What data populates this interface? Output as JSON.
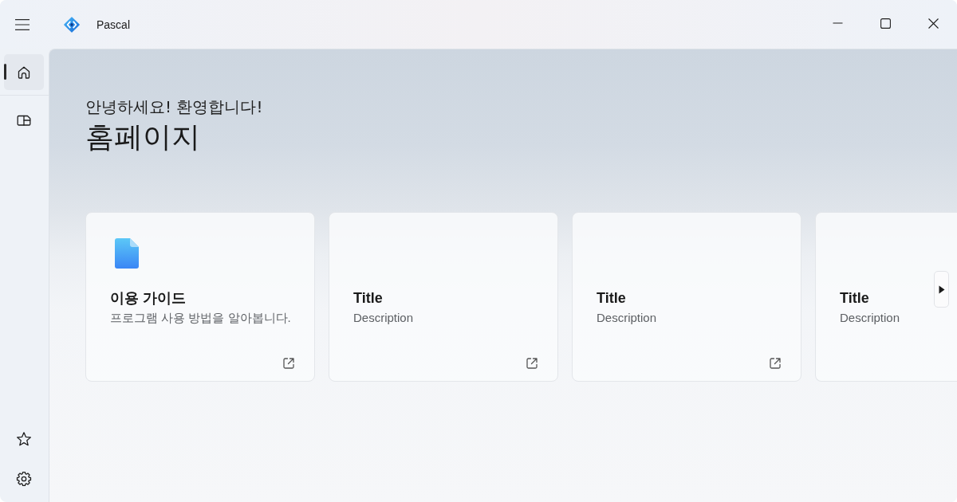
{
  "window": {
    "title": "Pascal"
  },
  "nav": {
    "sections": [
      {
        "items": [
          {
            "kind": "home",
            "selected": true
          }
        ]
      },
      {
        "items": [
          {
            "kind": "pages",
            "selected": false
          }
        ]
      }
    ],
    "footer_items": [
      {
        "kind": "star",
        "selected": false
      },
      {
        "kind": "settings",
        "selected": false
      }
    ]
  },
  "page": {
    "greeting": "안녕하세요! 환영합니다!",
    "title": "홈페이지"
  },
  "cards": [
    {
      "kind": "icon",
      "title": "이용 가이드",
      "description": "프로그램 사용 방법을 알아봅니다.",
      "external_link": true
    },
    {
      "kind": "plain",
      "title": "Title",
      "description": "Description",
      "external_link": true
    },
    {
      "kind": "plain",
      "title": "Title",
      "description": "Description",
      "external_link": true
    },
    {
      "kind": "plain",
      "title": "Title",
      "description": "Description",
      "external_link": false
    }
  ]
}
